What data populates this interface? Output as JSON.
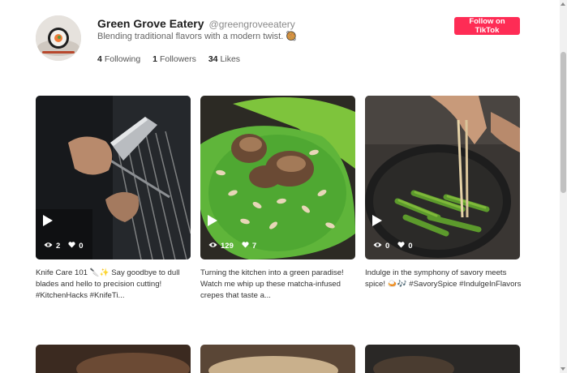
{
  "profile": {
    "name": "Green Grove Eatery",
    "handle": "@greengroveeatery",
    "bio": "Blending traditional flavors with a modern twist. 🥘",
    "following_count": "4",
    "following_label": "Following",
    "followers_count": "1",
    "followers_label": "Followers",
    "likes_count": "34",
    "likes_label": "Likes",
    "follow_button": "Follow on TikTok",
    "accent_color": "#fe2c55"
  },
  "videos": [
    {
      "views": "2",
      "likes": "0",
      "caption": "Knife Care 101 🔪✨ Say goodbye to dull blades and hello to precision cutting! #KitchenHacks #KnifeTi..."
    },
    {
      "views": "129",
      "likes": "7",
      "caption": "Turning the kitchen into a green paradise! Watch me whip up these matcha-infused crepes that taste a..."
    },
    {
      "views": "0",
      "likes": "0",
      "caption": "Indulge in the symphony of savory meets spice! 🍛🎶 #SavorySpice #IndulgeInFlavors"
    }
  ],
  "icons": {
    "play": "play-icon",
    "views": "eye-icon",
    "likes": "heart-icon"
  }
}
